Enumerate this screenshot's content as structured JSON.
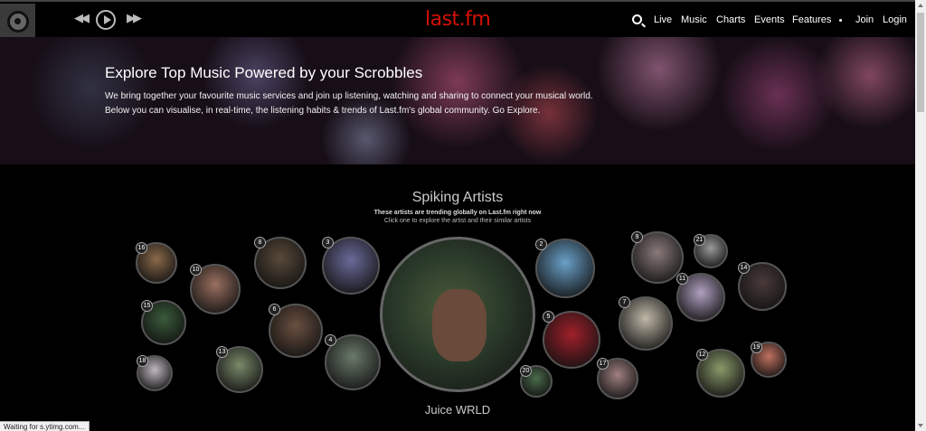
{
  "header": {
    "logo": "last.fm",
    "nav": [
      "Live",
      "Music",
      "Charts",
      "Events",
      "Features",
      "Join",
      "Login"
    ]
  },
  "hero": {
    "title": "Explore Top Music Powered by your Scrobbles",
    "line1": "We bring together your favourite music services and join up listening, watching and sharing to connect your musical world.",
    "line2": "Below you can visualise, in real-time, the listening habits & trends of Last.fm's global community. Go Explore."
  },
  "spiking": {
    "title": "Spiking Artists",
    "subtitle": "These artists are trending globally on Last.fm right now",
    "hint": "Click one to explore the artist and their similar artists",
    "featured": "Juice WRLD",
    "ranks": [
      "16",
      "10",
      "15",
      "18",
      "13",
      "8",
      "6",
      "3",
      "4",
      "2",
      "5",
      "20",
      "17",
      "9",
      "7",
      "11",
      "21",
      "14",
      "12",
      "19"
    ]
  },
  "status": "Waiting for s.ytimg.com...",
  "colors": {
    "brand": "#d51007"
  }
}
